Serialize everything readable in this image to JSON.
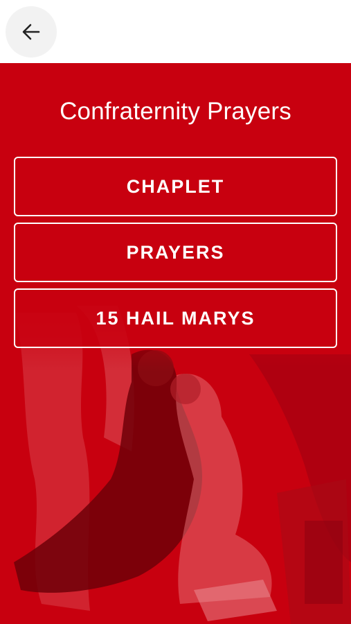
{
  "header": {
    "back_icon": "arrow-left-icon"
  },
  "main": {
    "title": "Confraternity Prayers",
    "menu": [
      {
        "label": "CHAPLET"
      },
      {
        "label": "PRAYERS"
      },
      {
        "label": "15 HAIL MARYS"
      }
    ],
    "background_image": "saint-kneeling-before-figure-painting"
  },
  "colors": {
    "accent_red": "#c8000f",
    "text": "#ffffff",
    "back_button_bg": "#f2f2f2"
  }
}
